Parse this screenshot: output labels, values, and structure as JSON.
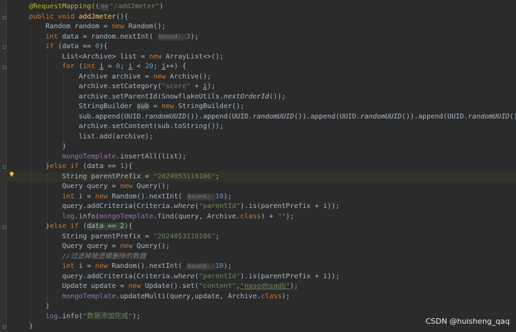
{
  "editor": {
    "lines": [
      {
        "ind": 4,
        "t": [
          [
            "ann",
            "@RequestMapping("
          ],
          [
            "",
            "("
          ],
          [
            "hint",
            "⊙∨"
          ],
          [
            "str",
            "\"/addJmeter\""
          ],
          [
            "",
            ")"
          ]
        ]
      },
      {
        "ind": 4,
        "t": [
          [
            "kw",
            "public void "
          ],
          [
            "st",
            "addJmeter"
          ],
          [
            "",
            "(){"
          ]
        ]
      },
      {
        "ind": 8,
        "t": [
          [
            "",
            "Random random = "
          ],
          [
            "kw",
            "new "
          ],
          [
            "",
            "Random();"
          ]
        ]
      },
      {
        "ind": 8,
        "t": [
          [
            "kw",
            "int "
          ],
          [
            "",
            "data = random.nextInt( "
          ],
          [
            "hint",
            "bound: "
          ],
          [
            "num",
            "3"
          ],
          [
            "",
            ");"
          ]
        ]
      },
      {
        "ind": 8,
        "t": [
          [
            "kw",
            "if "
          ],
          [
            "",
            "(data == "
          ],
          [
            "num",
            "0"
          ],
          [
            "",
            "){"
          ]
        ]
      },
      {
        "ind": 12,
        "t": [
          [
            "",
            "List<Archive> list = "
          ],
          [
            "kw",
            "new "
          ],
          [
            "",
            "ArrayList<>();"
          ]
        ]
      },
      {
        "ind": 12,
        "t": [
          [
            "kw",
            "for "
          ],
          [
            "",
            "("
          ],
          [
            "kw",
            "int "
          ],
          [
            "ul",
            "i"
          ],
          [
            "",
            " = "
          ],
          [
            "num",
            "0"
          ],
          [
            "",
            "; "
          ],
          [
            "ul",
            "i"
          ],
          [
            "",
            " < "
          ],
          [
            "num",
            "20"
          ],
          [
            "",
            "; "
          ],
          [
            "ul",
            "i"
          ],
          [
            "",
            "++) {"
          ]
        ]
      },
      {
        "ind": 16,
        "t": [
          [
            "",
            "Archive archive = "
          ],
          [
            "kw",
            "new "
          ],
          [
            "",
            "Archive();"
          ]
        ]
      },
      {
        "ind": 16,
        "t": [
          [
            "",
            "archive.setCategory("
          ],
          [
            "str",
            "\"score\""
          ],
          [
            "",
            " + "
          ],
          [
            "ul",
            "i"
          ],
          [
            "",
            ");"
          ]
        ]
      },
      {
        "ind": 16,
        "t": [
          [
            "",
            "archive.setParentId(SnowflakeUtils."
          ],
          [
            "it",
            "nextOrderId"
          ],
          [
            "",
            "());"
          ]
        ]
      },
      {
        "ind": 16,
        "t": [
          [
            "",
            "StringBuilder "
          ],
          [
            "occ",
            "sub"
          ],
          [
            "",
            " = "
          ],
          [
            "kw",
            "new "
          ],
          [
            "",
            "StringBuilder();"
          ]
        ]
      },
      {
        "ind": 16,
        "t": [
          [
            "",
            "sub.append(UUID."
          ],
          [
            "it",
            "randomUUID"
          ],
          [
            "",
            "()).append(UUID."
          ],
          [
            "it",
            "randomUUID"
          ],
          [
            "",
            "()).append(UUID."
          ],
          [
            "it",
            "randomUUID"
          ],
          [
            "",
            "()).append(UUID."
          ],
          [
            "it",
            "randomUUID"
          ],
          [
            "",
            "());"
          ]
        ]
      },
      {
        "ind": 16,
        "t": [
          [
            "",
            "archive.setContent(sub.toString());"
          ]
        ]
      },
      {
        "ind": 16,
        "t": [
          [
            "",
            "list.add(archive);"
          ]
        ]
      },
      {
        "ind": 12,
        "t": [
          [
            "",
            "}"
          ]
        ]
      },
      {
        "ind": 12,
        "t": [
          [
            "fld",
            "mongoTemplate"
          ],
          [
            "",
            ".insertAll(list);"
          ]
        ]
      },
      {
        "ind": 8,
        "t": [
          [
            "",
            "}"
          ],
          [
            "kw",
            "else if "
          ],
          [
            "",
            "(data == "
          ],
          [
            "num",
            "1"
          ],
          [
            "",
            "){"
          ]
        ]
      },
      {
        "ind": 12,
        "t": [
          [
            "",
            "String parentPrefix = "
          ],
          [
            "str",
            "\"2024053110106\""
          ],
          [
            "",
            ";"
          ]
        ]
      },
      {
        "ind": 12,
        "t": [
          [
            "",
            "Query query = "
          ],
          [
            "kw",
            "new "
          ],
          [
            "",
            "Query();"
          ]
        ]
      },
      {
        "ind": 12,
        "t": [
          [
            "kw",
            "int "
          ],
          [
            "",
            "i = "
          ],
          [
            "kw",
            "new "
          ],
          [
            "",
            "Random().nextInt( "
          ],
          [
            "hint",
            "bound: "
          ],
          [
            "num",
            "10"
          ],
          [
            "",
            ");"
          ]
        ]
      },
      {
        "ind": 12,
        "t": [
          [
            "",
            "query.addCriteria(Criteria."
          ],
          [
            "it",
            "where"
          ],
          [
            "",
            "("
          ],
          [
            "str",
            "\"parentId\""
          ],
          [
            "",
            ").is(parentPrefix + i));"
          ]
        ]
      },
      {
        "ind": 12,
        "t": [
          [
            "fld",
            "log"
          ],
          [
            "",
            ".info("
          ],
          [
            "fld",
            "mongoTemplate"
          ],
          [
            "",
            ".find(query, Archive."
          ],
          [
            "kw",
            "class"
          ],
          [
            "",
            ") + "
          ],
          [
            "str",
            "\"\""
          ],
          [
            "",
            ");"
          ]
        ]
      },
      {
        "ind": 8,
        "t": [
          [
            "",
            "}"
          ],
          [
            "kw",
            "else if "
          ],
          [
            "",
            "("
          ],
          [
            "occ",
            "data == 2"
          ],
          [
            "",
            "){"
          ]
        ]
      },
      {
        "ind": 12,
        "t": [
          [
            "",
            "String parentPrefix = "
          ],
          [
            "str",
            "\"2024053110106\""
          ],
          [
            "",
            ";"
          ]
        ]
      },
      {
        "ind": 12,
        "t": [
          [
            "",
            "Query query = "
          ],
          [
            "kw",
            "new "
          ],
          [
            "",
            "Query();"
          ]
        ]
      },
      {
        "ind": 12,
        "t": [
          [
            "cmt",
            "//过滤掉被逻辑删除的数据"
          ]
        ]
      },
      {
        "ind": 12,
        "t": [
          [
            "kw",
            "int "
          ],
          [
            "",
            "i = "
          ],
          [
            "kw",
            "new "
          ],
          [
            "",
            "Random().nextInt( "
          ],
          [
            "hint",
            "bound: "
          ],
          [
            "num",
            "10"
          ],
          [
            "",
            ");"
          ]
        ]
      },
      {
        "ind": 12,
        "t": [
          [
            "",
            "query.addCriteria(Criteria."
          ],
          [
            "it",
            "where"
          ],
          [
            "",
            "("
          ],
          [
            "str",
            "\"parentId\""
          ],
          [
            "",
            ").is(parentPrefix + i));"
          ]
        ]
      },
      {
        "ind": 12,
        "t": [
          [
            "",
            "Update update = "
          ],
          [
            "kw",
            "new "
          ],
          [
            "",
            "Update().set("
          ],
          [
            "str",
            "\"content\""
          ],
          [
            "",
            ","
          ],
          [
            "str linkish",
            "\"nasodhsadb\""
          ],
          [
            "",
            ");"
          ]
        ]
      },
      {
        "ind": 12,
        "t": [
          [
            "fld",
            "mongoTemplate"
          ],
          [
            "",
            ".updateMulti(query,update, Archive."
          ],
          [
            "kw",
            "class"
          ],
          [
            "",
            ");"
          ]
        ]
      },
      {
        "ind": 8,
        "t": [
          [
            "",
            "}"
          ]
        ]
      },
      {
        "ind": 8,
        "t": [
          [
            "fld",
            "log"
          ],
          [
            "",
            ".info("
          ],
          [
            "str",
            "\"数据添加完成\""
          ],
          [
            "",
            ");"
          ]
        ]
      },
      {
        "ind": 4,
        "t": [
          [
            "",
            "}"
          ]
        ]
      }
    ]
  },
  "watermark": "CSDN @huisheng_qaq",
  "colors": {
    "background": "#2b2b2b",
    "keyword": "#cc7832",
    "string": "#6a8759",
    "number": "#6897bb",
    "annotation": "#bbb529",
    "field": "#9876aa",
    "method_decl": "#ffc66d",
    "comment": "#808080"
  },
  "icons": [
    "lightbulb-icon",
    "fold-marker-icon"
  ]
}
